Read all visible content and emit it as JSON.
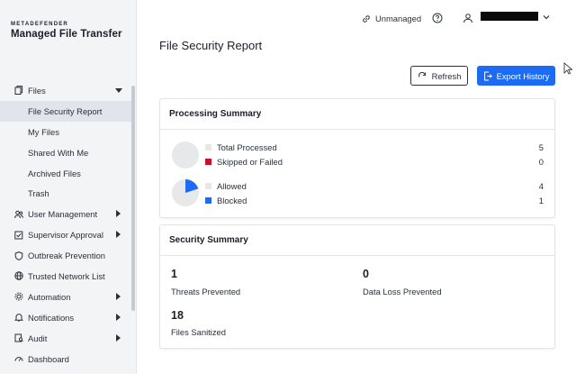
{
  "brand": {
    "top": "METADEFENDER",
    "main": "Managed File Transfer"
  },
  "topbar": {
    "status_label": "Unmanaged",
    "status_icon": "link-icon",
    "help_icon": "help-circle-icon",
    "user_icon": "user-icon"
  },
  "sidebar": {
    "items": [
      {
        "label": "Files",
        "icon": "files-icon",
        "expanded": true
      },
      {
        "label": "File Security Report",
        "active": true
      },
      {
        "label": "My Files"
      },
      {
        "label": "Shared With Me"
      },
      {
        "label": "Archived Files"
      },
      {
        "label": "Trash"
      },
      {
        "label": "User Management",
        "icon": "users-icon"
      },
      {
        "label": "Supervisor Approval",
        "icon": "approval-icon"
      },
      {
        "label": "Outbreak Prevention",
        "icon": "shield-icon"
      },
      {
        "label": "Trusted Network List",
        "icon": "globe-icon"
      },
      {
        "label": "Automation",
        "icon": "automation-icon"
      },
      {
        "label": "Notifications",
        "icon": "bell-icon"
      },
      {
        "label": "Audit",
        "icon": "audit-icon"
      },
      {
        "label": "Dashboard",
        "icon": "dashboard-icon"
      }
    ]
  },
  "main": {
    "title": "File Security Report",
    "refresh_label": "Refresh",
    "export_label": "Export History"
  },
  "processing": {
    "title": "Processing Summary",
    "total_processed_label": "Total Processed",
    "total_processed_value": "5",
    "skipped_label": "Skipped or Failed",
    "skipped_value": "0",
    "allowed_label": "Allowed",
    "allowed_value": "4",
    "blocked_label": "Blocked",
    "blocked_value": "1"
  },
  "security": {
    "title": "Security Summary",
    "threats_value": "1",
    "threats_label": "Threats Prevented",
    "dataloss_value": "0",
    "dataloss_label": "Data Loss Prevented",
    "sanitized_value": "18",
    "sanitized_label": "Files Sanitized"
  },
  "colors": {
    "accent": "#1d6bf3",
    "failed": "#c8102e",
    "neutral": "#e7e8ea"
  }
}
